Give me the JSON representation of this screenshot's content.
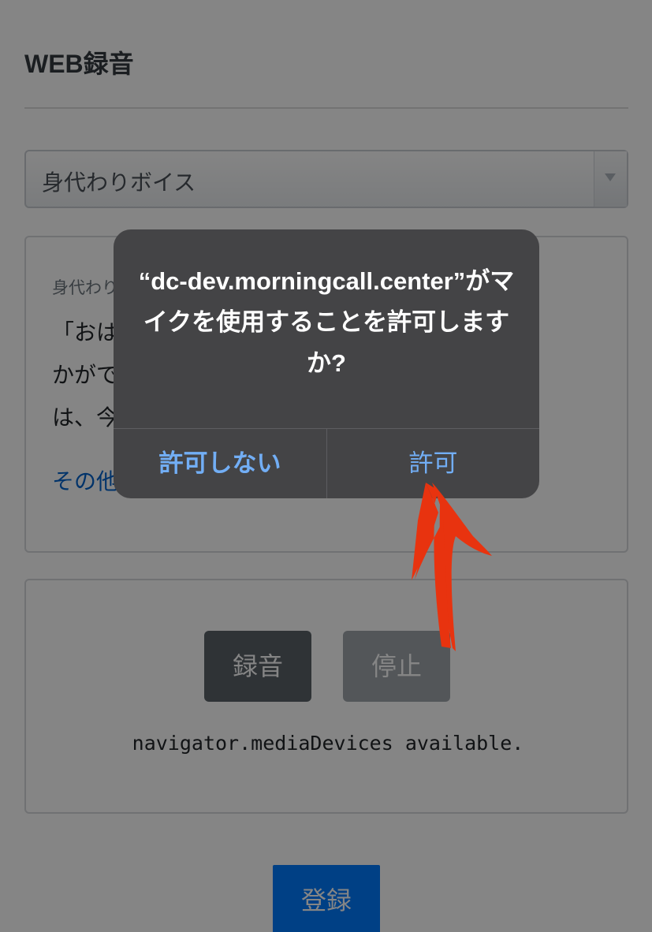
{
  "page": {
    "title": "WEB録音",
    "voice_select": {
      "value": "身代わりボイス"
    },
    "script_card": {
      "heading": "身代わり",
      "lines": [
        "「おは",
        "かがで",
        "は、今"
      ],
      "link_text": "その他"
    },
    "record_card": {
      "record_label": "録音",
      "stop_label": "停止",
      "status": "navigator.mediaDevices available."
    },
    "register_label": "登録"
  },
  "alert": {
    "title": "“dc-dev.morningcall.center”がマイクを使用することを許可しますか?",
    "deny_label": "許可しない",
    "allow_label": "許可"
  },
  "colors": {
    "alert_background": "#444446",
    "alert_button_text": "#72aef5",
    "annotation_arrow": "#e8330f",
    "primary_button": "#007bff"
  },
  "icons": {
    "select_arrow": "triangle-down",
    "annotation": "red-hand-drawn-arrow"
  }
}
